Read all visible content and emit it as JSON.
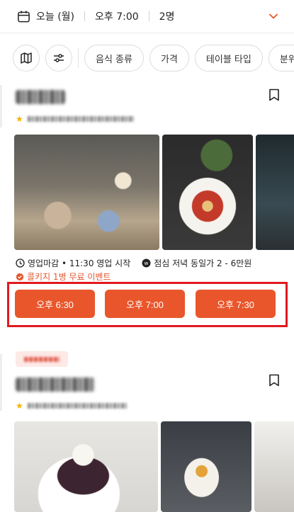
{
  "booking_bar": {
    "date": "오늘 (월)",
    "time": "오후 7:00",
    "party": "2명"
  },
  "filters": {
    "chips": [
      "음식 종류",
      "가격",
      "테이블 타입",
      "분위"
    ]
  },
  "restaurant_1": {
    "hours": "영업마감 • 11:30 영업 시작",
    "price": "점심 저녁 동일가 2 - 6만원",
    "event": "콜키지 1병 무료 이벤트",
    "times": [
      "오후 6:30",
      "오후 7:00",
      "오후 7:30"
    ]
  },
  "colors": {
    "accent": "#e9562b",
    "highlight_box": "#e1191f",
    "event_text": "#e4572e",
    "star": "#f5b301"
  },
  "icons": {
    "calendar": "calendar-icon",
    "chevron": "chevron-down-icon",
    "map": "map-icon",
    "filter": "sliders-icon",
    "bookmark": "bookmark-icon"
  }
}
